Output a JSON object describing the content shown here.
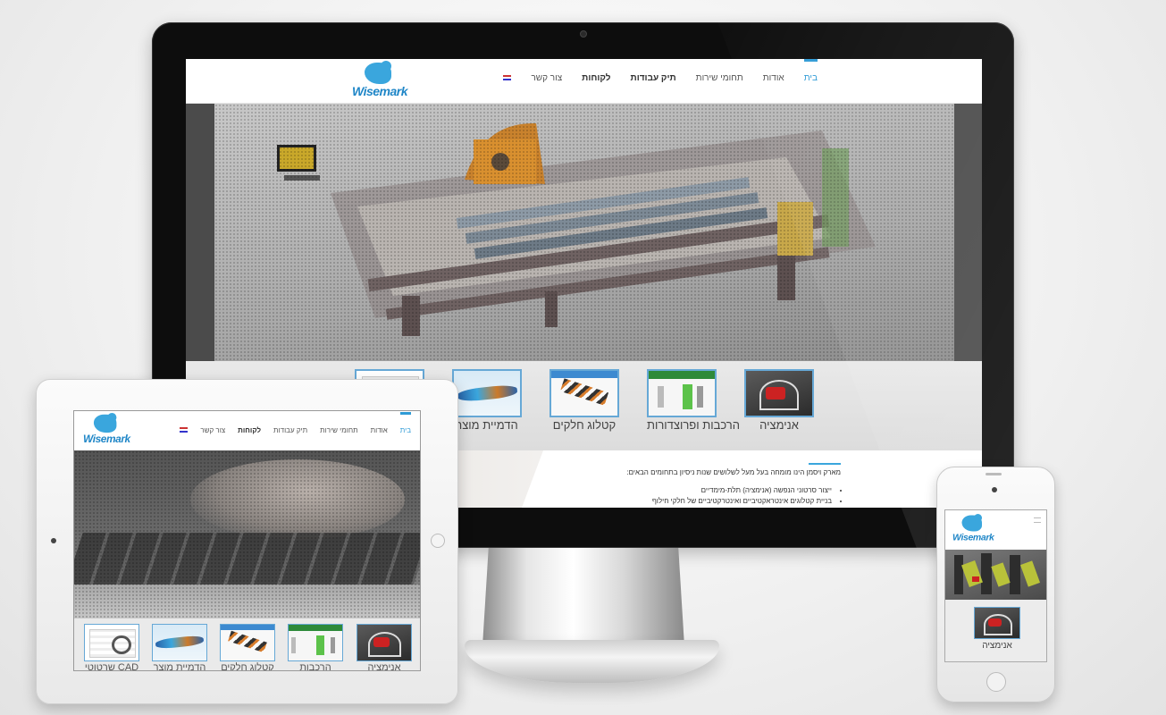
{
  "brand": {
    "logo_text": "Wisemark",
    "accent": "#3aa6dd"
  },
  "nav": {
    "items": [
      {
        "label": "בית",
        "active": true
      },
      {
        "label": "אודות"
      },
      {
        "label": "תחומי שירות"
      },
      {
        "label": "תיק עבודות"
      },
      {
        "label": "לקוחות"
      },
      {
        "label": "צור קשר"
      }
    ],
    "language_flag": "us-flag-icon"
  },
  "thumbnails": {
    "desktop": [
      {
        "label": "אנימציה",
        "icon": "animation"
      },
      {
        "label": "הרכבות ופרוצדורות",
        "icon": "installation"
      },
      {
        "label": "קטלוג חלקים",
        "icon": "parts-catalog"
      },
      {
        "label": "הדמיית מוצר",
        "icon": "product-simulation"
      }
    ],
    "tablet": [
      {
        "label": "אנימציה"
      },
      {
        "label": "הרכבות"
      },
      {
        "label": "קטלוג חלקים"
      },
      {
        "label": "הדמיית מוצר"
      },
      {
        "label": "שרטוטי CAD"
      }
    ],
    "phone": [
      {
        "label": "אנימציה"
      }
    ]
  },
  "content": {
    "intro": "מארק ויסמן הינו מומחה בעל מעל לשלושים שנות ניסיון בתחומים הבאים:",
    "bullets": [
      "ייצור סרטוני הנפשה (אנימציה) תלת-מימדיים",
      "בניית קטלוגים אינטראקטיביים ואינטרקטיביים של חלקי חילוף"
    ]
  }
}
